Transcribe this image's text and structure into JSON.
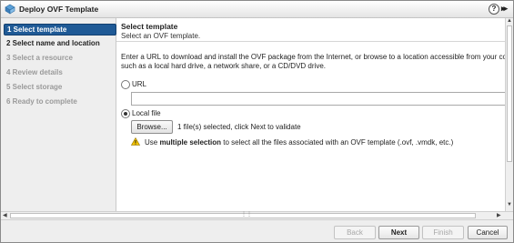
{
  "window": {
    "title": "Deploy OVF Template",
    "help_label": "?",
    "expand_label": "▸▸"
  },
  "steps": [
    {
      "label": "1  Select template",
      "state": "active"
    },
    {
      "label": "2  Select name and location",
      "state": "enabled"
    },
    {
      "label": "3  Select a resource",
      "state": "disabled"
    },
    {
      "label": "4  Review details",
      "state": "disabled"
    },
    {
      "label": "5  Select storage",
      "state": "disabled"
    },
    {
      "label": "6  Ready to complete",
      "state": "disabled"
    }
  ],
  "content": {
    "title": "Select template",
    "subtitle": "Select an OVF template.",
    "description_line1": "Enter a URL to download and install the OVF package from the Internet, or browse to a location accessible from your compu",
    "description_line2": "such as a local hard drive, a network share, or a CD/DVD drive.",
    "url_option_label": "URL",
    "url_value": "",
    "local_file_option_label": "Local file",
    "selected_option": "local_file",
    "browse_label": "Browse...",
    "file_status": "1 file(s) selected, click Next to validate",
    "warning_prefix": "Use ",
    "warning_bold": "multiple selection",
    "warning_suffix": " to select all the files associated with an OVF template (.ovf, .vmdk, etc.)"
  },
  "footer": {
    "back_label": "Back",
    "next_label": "Next",
    "finish_label": "Finish",
    "cancel_label": "Cancel"
  },
  "colors": {
    "active_step": "#1f5a96",
    "warning": "#f2c200"
  }
}
